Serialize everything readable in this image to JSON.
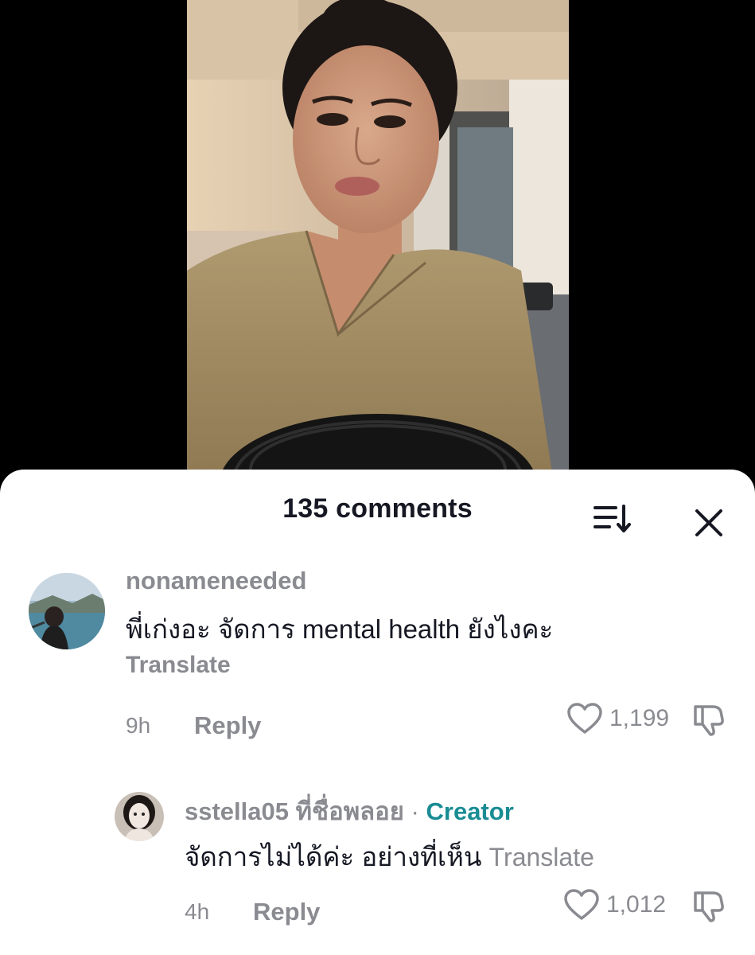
{
  "comments_sheet": {
    "title": "135 comments",
    "sort_icon": "sort-icon",
    "close_icon": "close-icon"
  },
  "comments": [
    {
      "username": "nonameneeded",
      "text": "พี่เก่งอะ จัดการ mental health ยังไงคะ",
      "translate": "Translate",
      "time": "9h",
      "reply": "Reply",
      "likes": "1,199"
    }
  ],
  "replies": [
    {
      "username": "sstella05 ที่ชื่อพลอย",
      "separator": "·",
      "badge": "Creator",
      "text": "จัดการไม่ได้ค่ะ อย่างที่เห็น",
      "translate": "Translate",
      "time": "4h",
      "reply": "Reply",
      "likes": "1,012"
    }
  ],
  "colors": {
    "creator_badge": "#1a8c94",
    "secondary_text": "#8a8b91",
    "primary_text": "#161823"
  }
}
